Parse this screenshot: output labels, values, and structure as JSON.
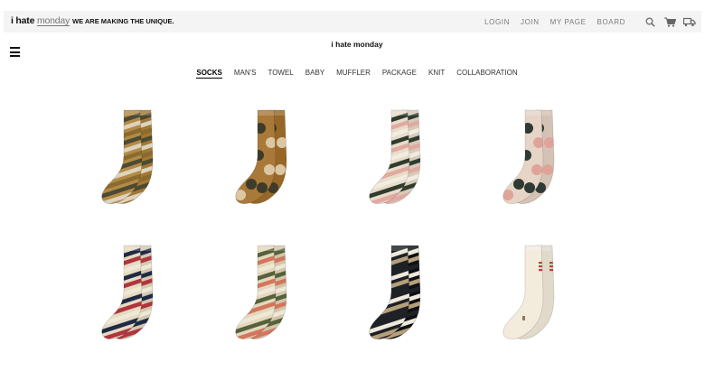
{
  "brand": {
    "part1": "i hate",
    "part2": "monday",
    "tagline": "WE ARE MAKING THE UNIQUE."
  },
  "topnav": {
    "login": "LOGIN",
    "join": "JOIN",
    "mypage": "MY PAGE",
    "board": "BOARD"
  },
  "icons": [
    "search-icon",
    "cart-icon",
    "delivery-truck-icon"
  ],
  "site_title": "i hate monday",
  "categories": [
    {
      "label": "SOCKS",
      "active": true
    },
    {
      "label": "MAN'S"
    },
    {
      "label": "TOWEL"
    },
    {
      "label": "BABY"
    },
    {
      "label": "MUFFLER"
    },
    {
      "label": "PACKAGE"
    },
    {
      "label": "KNIT"
    },
    {
      "label": "COLLABORATION"
    }
  ],
  "products": [
    {
      "style": "stripe",
      "base": "#b38a46",
      "colors": [
        "#4b4a32",
        "#ddd3bd",
        "#8a6a2e"
      ]
    },
    {
      "style": "dots",
      "base": "#a9793a",
      "colors": [
        "#3e3b2a",
        "#dcc7a3"
      ]
    },
    {
      "style": "stripe",
      "base": "#e8dccb",
      "colors": [
        "#2f3c2e",
        "#e2a9a0",
        "#f2ece0"
      ]
    },
    {
      "style": "dots",
      "base": "#e6d5c6",
      "colors": [
        "#2e3a33",
        "#e0a39a"
      ]
    },
    {
      "style": "stripe",
      "base": "#e5dbc3",
      "colors": [
        "#1f2a44",
        "#b0353d",
        "#efe8d6"
      ]
    },
    {
      "style": "stripe",
      "base": "#e3d7bd",
      "colors": [
        "#55623a",
        "#d3765c",
        "#efe8d6"
      ]
    },
    {
      "style": "stripe",
      "base": "#1e2125",
      "colors": [
        "#efe9dc",
        "#b59f7c",
        "#1e2125"
      ]
    },
    {
      "style": "plain",
      "base": "#f3ecdd",
      "colors": [
        "#b5443e",
        "#8a7a5c"
      ]
    }
  ]
}
